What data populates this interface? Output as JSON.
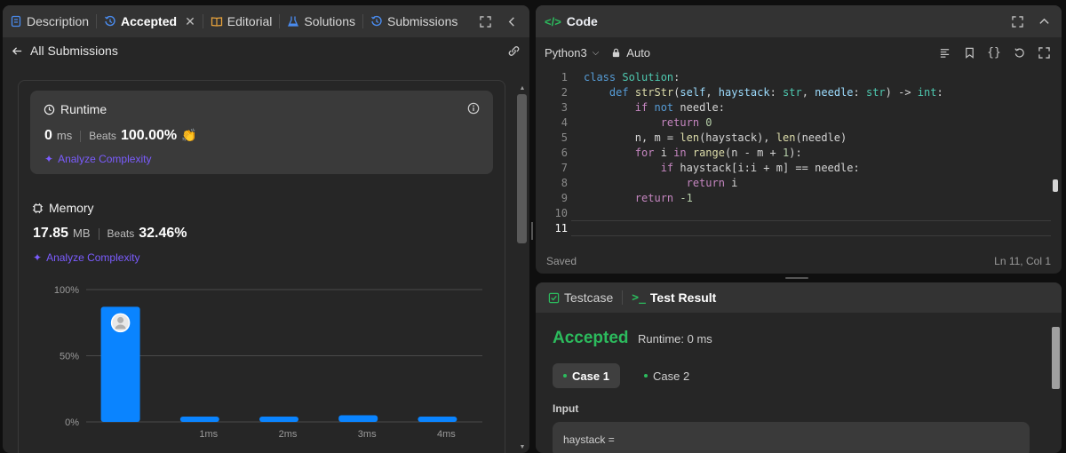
{
  "left_tabs": [
    {
      "label": "Description",
      "icon": "document-icon"
    },
    {
      "label": "Accepted",
      "icon": "history-icon",
      "active": true
    },
    {
      "label": "Editorial",
      "icon": "book-icon"
    },
    {
      "label": "Solutions",
      "icon": "flask-icon"
    },
    {
      "label": "Submissions",
      "icon": "history-icon"
    }
  ],
  "back_label": "All Submissions",
  "runtime": {
    "title": "Runtime",
    "value": "0",
    "unit": "ms",
    "beats_label": "Beats",
    "beats_value": "100.00%",
    "analyze": "Analyze Complexity"
  },
  "memory": {
    "title": "Memory",
    "value": "17.85",
    "unit": "MB",
    "beats_label": "Beats",
    "beats_value": "32.46%",
    "analyze": "Analyze Complexity"
  },
  "chart_data": {
    "type": "bar",
    "categories": [
      "",
      "1ms",
      "2ms",
      "3ms",
      "4ms"
    ],
    "values": [
      87,
      4,
      4,
      5,
      4
    ],
    "yticks": [
      "100%",
      "50%",
      "0%"
    ],
    "ylim": [
      0,
      100
    ],
    "highlight_index": 0,
    "bar_color": "#0a84ff"
  },
  "code": {
    "title": "Code",
    "language": "Python3",
    "mode": "Auto",
    "status": "Saved",
    "cursor": "Ln 11, Col 1",
    "line_numbers": [
      "1",
      "2",
      "3",
      "4",
      "5",
      "6",
      "7",
      "8",
      "9",
      "10",
      "11"
    ]
  },
  "result": {
    "tabs": [
      "Testcase",
      "Test Result"
    ],
    "verdict": "Accepted",
    "runtime": "Runtime: 0 ms",
    "cases": [
      "Case 1",
      "Case 2"
    ],
    "input_label": "Input",
    "input_text": "haystack ="
  }
}
